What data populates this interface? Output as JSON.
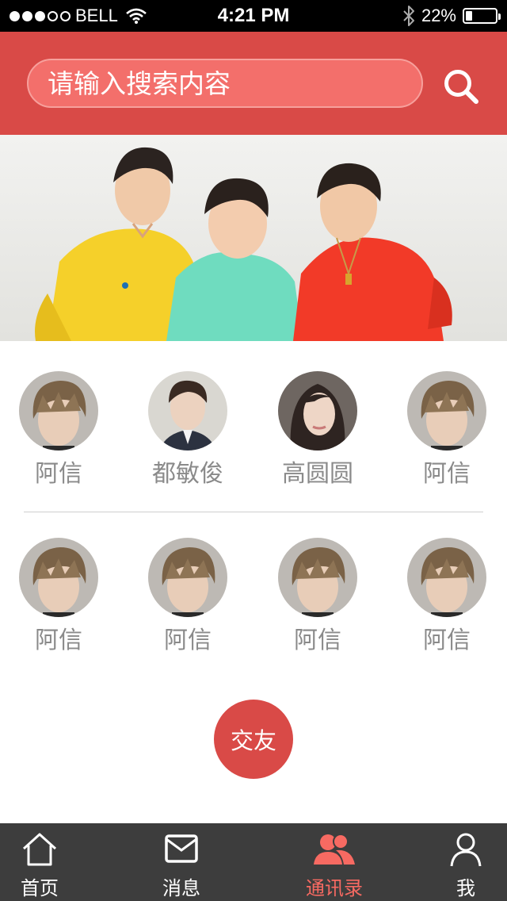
{
  "status_bar": {
    "carrier": "BELL",
    "time": "4:21 PM",
    "battery_percent_text": "22%",
    "battery_level": 0.22,
    "signal_dots_filled": 3,
    "signal_dots_total": 5
  },
  "search": {
    "placeholder": "请输入搜索内容",
    "icon": "search-icon"
  },
  "banner": {
    "image": "group-photo-three-boys"
  },
  "contacts": {
    "row1": [
      {
        "name": "阿信",
        "avatar": "avatar-brown-hair-man"
      },
      {
        "name": "都敏俊",
        "avatar": "avatar-man-in-suit"
      },
      {
        "name": "高圆圆",
        "avatar": "avatar-woman-long-hair"
      },
      {
        "name": "阿信",
        "avatar": "avatar-brown-hair-man"
      }
    ],
    "row2": [
      {
        "name": "阿信",
        "avatar": "avatar-brown-hair-man"
      },
      {
        "name": "阿信",
        "avatar": "avatar-brown-hair-man"
      },
      {
        "name": "阿信",
        "avatar": "avatar-brown-hair-man"
      },
      {
        "name": "阿信",
        "avatar": "avatar-brown-hair-man"
      }
    ]
  },
  "friend_button": {
    "label": "交友"
  },
  "tabbar": {
    "tabs": [
      {
        "label": "首页",
        "icon": "home-icon",
        "active": false
      },
      {
        "label": "消息",
        "icon": "mail-icon",
        "active": false
      },
      {
        "label": "通讯录",
        "icon": "contacts-icon",
        "active": true
      },
      {
        "label": "我",
        "icon": "user-icon",
        "active": false
      }
    ]
  },
  "colors": {
    "header_red": "#d94a47",
    "search_field": "#f36f6b",
    "active_tab": "#f76a62",
    "tabbar_bg": "#3d3d3d"
  }
}
